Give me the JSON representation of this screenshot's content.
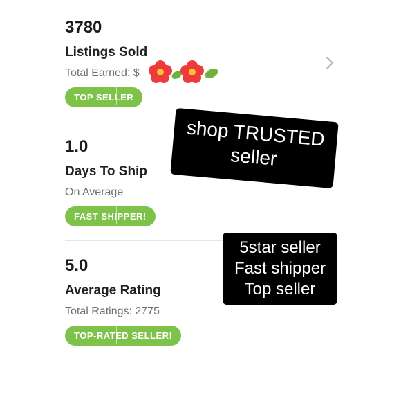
{
  "stats": [
    {
      "value": "3780",
      "label": "Listings Sold",
      "sub": "Total Earned: $",
      "badge": "TOP SELLER"
    },
    {
      "value": "1.0",
      "label": "Days To Ship",
      "sub": "On Average",
      "badge": "FAST SHIPPER!"
    },
    {
      "value": "5.0",
      "label": "Average Rating",
      "sub": "Total Ratings: 2775",
      "badge": "TOP-RATED SELLER!"
    }
  ],
  "stickers": {
    "trusted": [
      "shop TRUSTED",
      "seller"
    ],
    "summary": [
      "5star seller",
      "Fast shipper",
      "Top seller"
    ]
  },
  "colors": {
    "badge_green": "#7ec24a",
    "sticker_black": "#000000",
    "flower_red": "#ef3b3b",
    "leaf_green": "#6cb33f"
  },
  "icons": {
    "chevron": "chevron-right-icon",
    "flowers": "flower-sticker-icon"
  }
}
